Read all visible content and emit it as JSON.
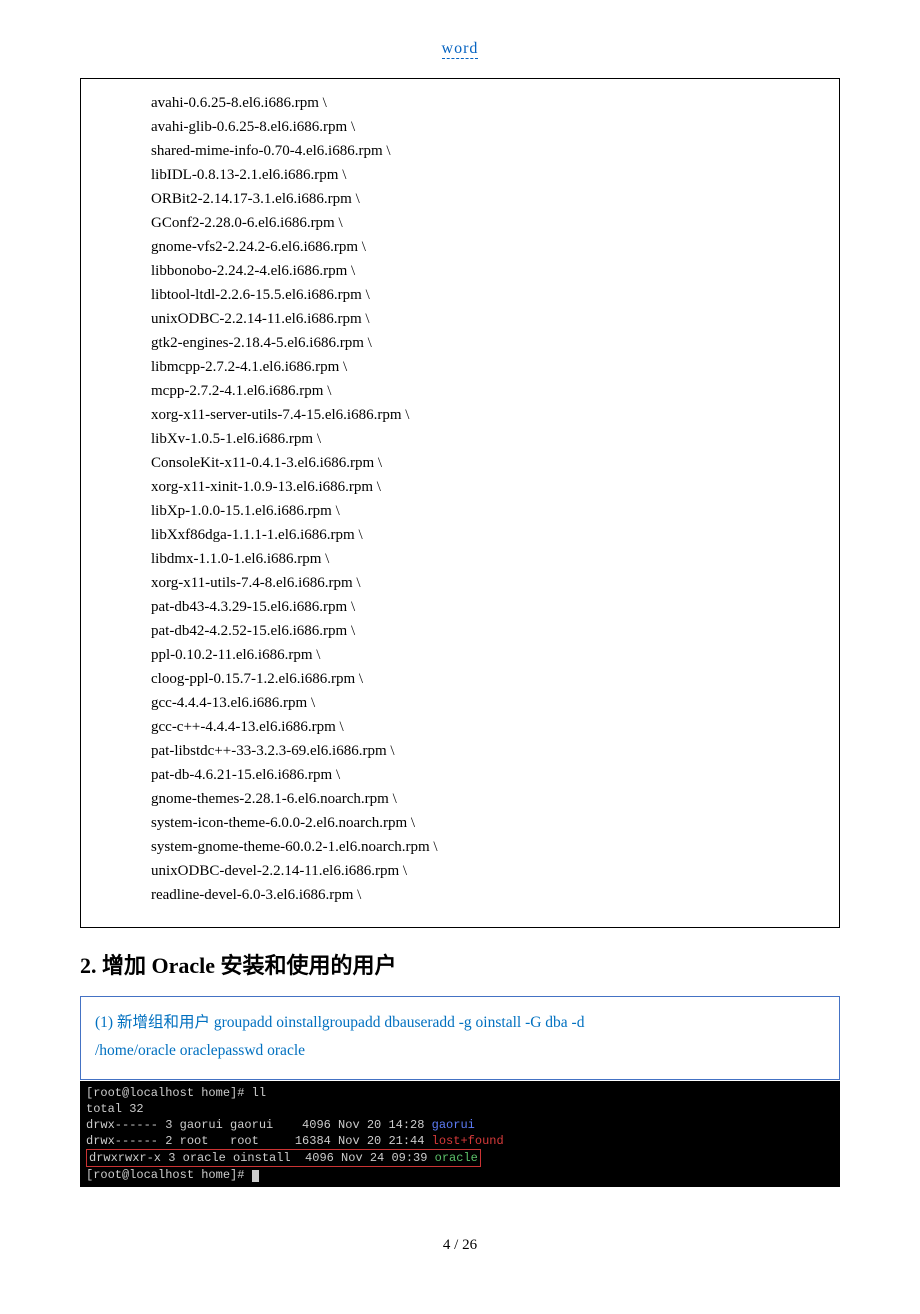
{
  "header": {
    "link": "word"
  },
  "packages": [
    "avahi-0.6.25-8.el6.i686.rpm \\",
    "avahi-glib-0.6.25-8.el6.i686.rpm \\",
    "shared-mime-info-0.70-4.el6.i686.rpm \\",
    "libIDL-0.8.13-2.1.el6.i686.rpm \\",
    "ORBit2-2.14.17-3.1.el6.i686.rpm \\",
    "GConf2-2.28.0-6.el6.i686.rpm \\",
    "gnome-vfs2-2.24.2-6.el6.i686.rpm \\",
    "libbonobo-2.24.2-4.el6.i686.rpm \\",
    "libtool-ltdl-2.2.6-15.5.el6.i686.rpm \\",
    "unixODBC-2.2.14-11.el6.i686.rpm \\",
    "gtk2-engines-2.18.4-5.el6.i686.rpm \\",
    "libmcpp-2.7.2-4.1.el6.i686.rpm \\",
    "mcpp-2.7.2-4.1.el6.i686.rpm \\",
    "xorg-x11-server-utils-7.4-15.el6.i686.rpm \\",
    "libXv-1.0.5-1.el6.i686.rpm \\",
    "ConsoleKit-x11-0.4.1-3.el6.i686.rpm \\",
    "xorg-x11-xinit-1.0.9-13.el6.i686.rpm \\",
    "libXp-1.0.0-15.1.el6.i686.rpm \\",
    "libXxf86dga-1.1.1-1.el6.i686.rpm \\",
    "libdmx-1.1.0-1.el6.i686.rpm \\",
    "xorg-x11-utils-7.4-8.el6.i686.rpm \\",
    "pat-db43-4.3.29-15.el6.i686.rpm \\",
    "pat-db42-4.2.52-15.el6.i686.rpm \\",
    "ppl-0.10.2-11.el6.i686.rpm \\",
    "cloog-ppl-0.15.7-1.2.el6.i686.rpm \\",
    "gcc-4.4.4-13.el6.i686.rpm \\",
    "gcc-c++-4.4.4-13.el6.i686.rpm \\",
    "pat-libstdc++-33-3.2.3-69.el6.i686.rpm \\",
    "pat-db-4.6.21-15.el6.i686.rpm \\",
    "gnome-themes-2.28.1-6.el6.noarch.rpm \\",
    "system-icon-theme-6.0.0-2.el6.noarch.rpm \\",
    "system-gnome-theme-60.0.2-1.el6.noarch.rpm \\",
    "unixODBC-devel-2.2.14-11.el6.i686.rpm \\",
    "readline-devel-6.0-3.el6.i686.rpm \\"
  ],
  "section": {
    "heading": "2. 增加 Oracle 安装和使用的用户"
  },
  "command": {
    "num": "(1)",
    "label": " 新增组和用户 ",
    "cmd1": "groupadd oinstallgroupadd dbauseradd -g oinstall -G dba -d",
    "cmd2": "/home/oracle oraclepasswd oracle"
  },
  "terminal": {
    "prompt1": "[root@localhost home]# ll",
    "total": "total 32",
    "row1_perm": "drwx------ 3 gaorui gaorui    4096 Nov 20 14:28 ",
    "row1_name": "gaorui",
    "row2_perm": "drwx------ 2 root   root     16384 Nov 20 21:44 ",
    "row2_name": "lost+found",
    "row3_perm": "drwxrwxr-x 3 oracle oinstall  4096 Nov 24 09:39 ",
    "row3_name": "oracle",
    "prompt2": "[root@localhost home]# "
  },
  "footer": {
    "pagenum": "4  /  26"
  }
}
